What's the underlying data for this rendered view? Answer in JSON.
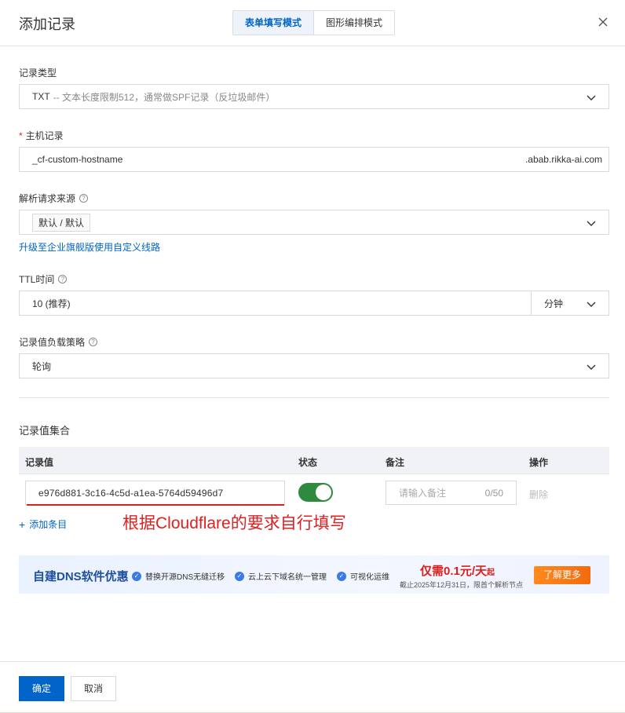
{
  "header": {
    "title": "添加记录",
    "modes": [
      "表单填写模式",
      "图形编排模式"
    ]
  },
  "record_type": {
    "label": "记录类型",
    "value_type": "TXT",
    "value_desc": "-- 文本长度限制512，通常做SPF记录（反垃圾邮件）"
  },
  "host_record": {
    "required_mark": "*",
    "label": "主机记录",
    "value": "_cf-custom-hostname",
    "suffix": ".abab.rikka-ai.com"
  },
  "resolve_source": {
    "label": "解析请求来源",
    "value": "默认 / 默认",
    "upgrade_link": "升级至企业旗舰版使用自定义线路"
  },
  "ttl": {
    "label": "TTL时间",
    "value": "10 (推荐)",
    "unit": "分钟"
  },
  "load_strategy": {
    "label": "记录值负载策略",
    "value": "轮询"
  },
  "record_set": {
    "title": "记录值集合",
    "columns": [
      "记录值",
      "状态",
      "备注",
      "操作"
    ],
    "row": {
      "value": "e976d881-3c16-4c5d-a1ea-5764d59496d7",
      "enabled": true,
      "note_placeholder": "请输入备注",
      "note_count": "0/50",
      "delete": "删除"
    },
    "add_item": "添加条目",
    "annotation": "根据Cloudflare的要求自行填写"
  },
  "banner": {
    "title": "自建DNS软件优惠",
    "features": [
      "替换开源DNS无缝迁移",
      "云上云下域名统一管理",
      "可视化运维"
    ],
    "price_main": "仅需0.1元/天",
    "price_suffix": "起",
    "price_note": "截止2025年12月31日，限首个解析节点",
    "more": "了解更多"
  },
  "footer": {
    "confirm": "确定",
    "cancel": "取消"
  },
  "colors": {
    "primary": "#0064c8",
    "toggle_on": "#2d8a3e",
    "annotation": "#e02020",
    "price": "#d9221c",
    "cta": "#f26a0f"
  }
}
